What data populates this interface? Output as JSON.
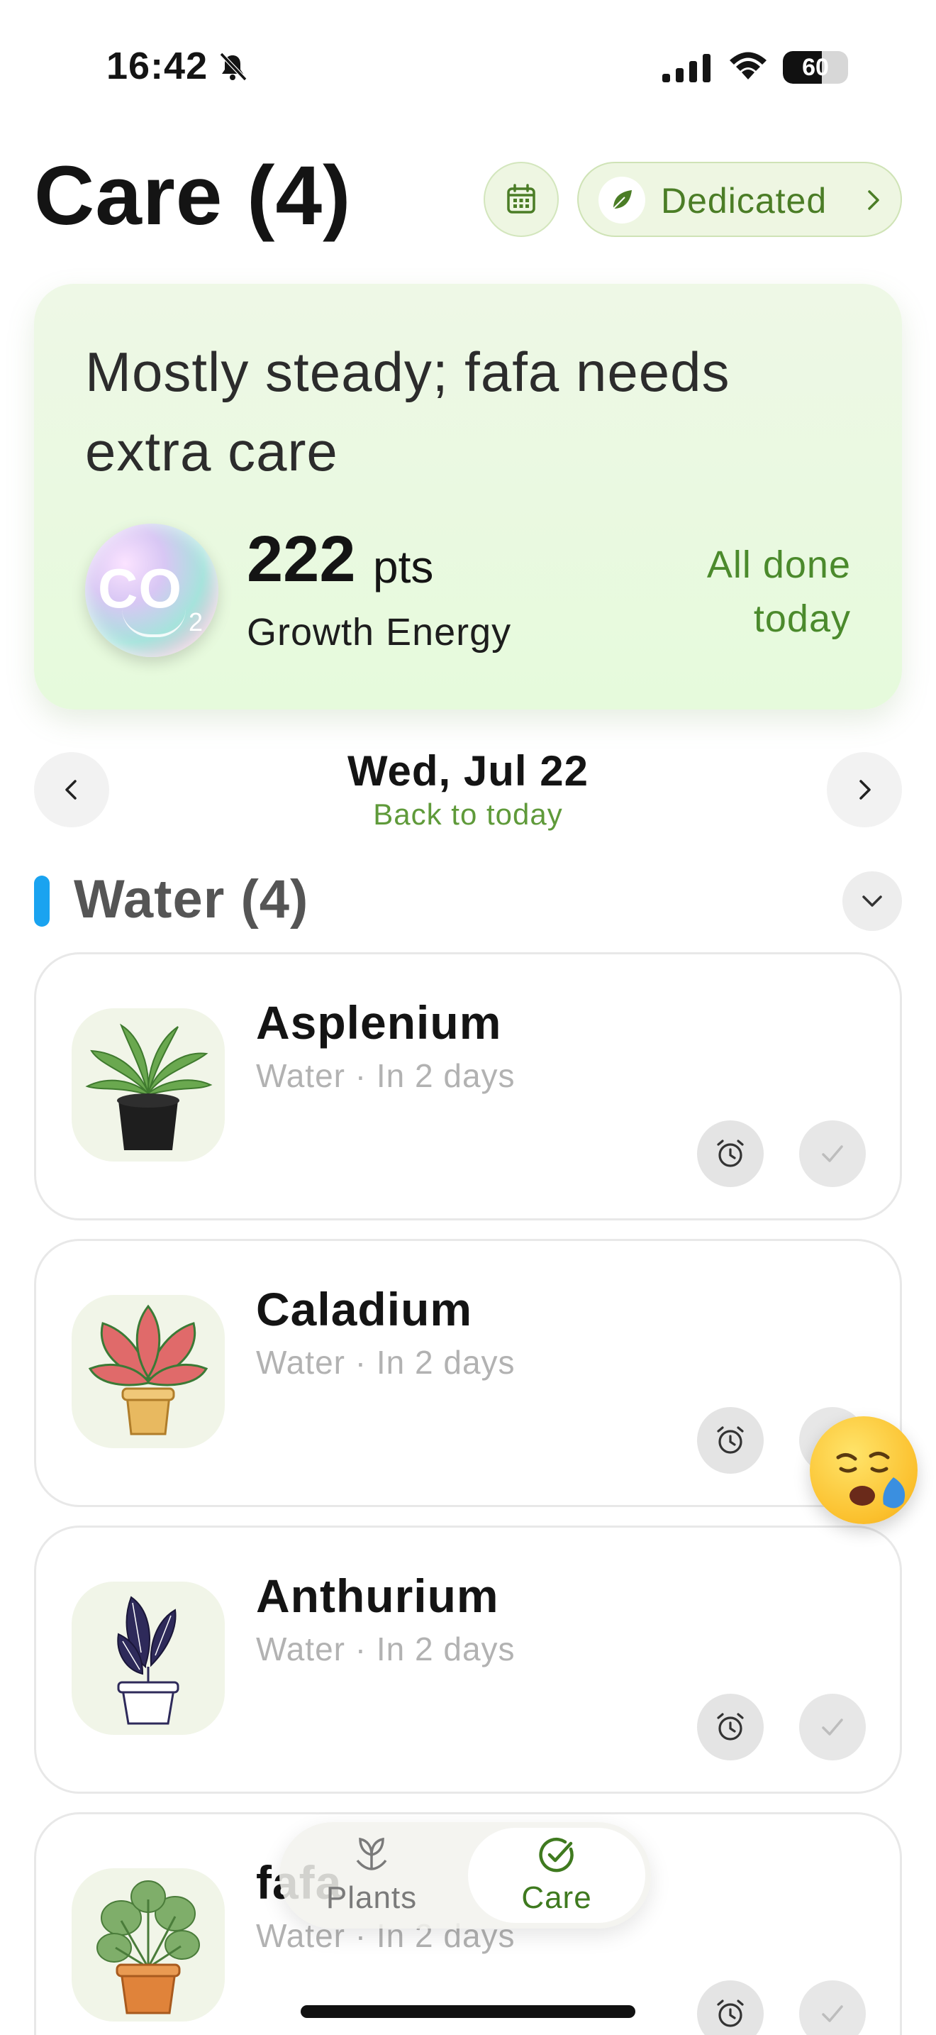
{
  "status_bar": {
    "time": "16:42",
    "battery_level": "60"
  },
  "header": {
    "title": "Care (4)",
    "dedicated_label": "Dedicated"
  },
  "summary": {
    "message": "Mostly steady; fafa needs extra care",
    "badge_text": "CO",
    "badge_subscript": "2",
    "points_value": "222",
    "points_unit": "pts",
    "points_label": "Growth Energy",
    "status": "All done today"
  },
  "date_nav": {
    "date": "Wed, Jul 22",
    "back_link": "Back to today"
  },
  "section": {
    "title": "Water (4)",
    "accent_color": "#1aa3f0"
  },
  "plants": [
    {
      "name": "Asplenium",
      "task": "Water · In 2 days"
    },
    {
      "name": "Caladium",
      "task": "Water · In 2 days"
    },
    {
      "name": "Anthurium",
      "task": "Water · In 2 days"
    },
    {
      "name": "fafa",
      "task": "Water · In 2 days"
    }
  ],
  "tabs": [
    {
      "label": "Plants",
      "icon": "sprout-icon"
    },
    {
      "label": "Care",
      "icon": "check-circle-icon",
      "active": true
    }
  ],
  "colors": {
    "brand_green": "#4b7d26",
    "card_bg": "#e9f8df"
  }
}
